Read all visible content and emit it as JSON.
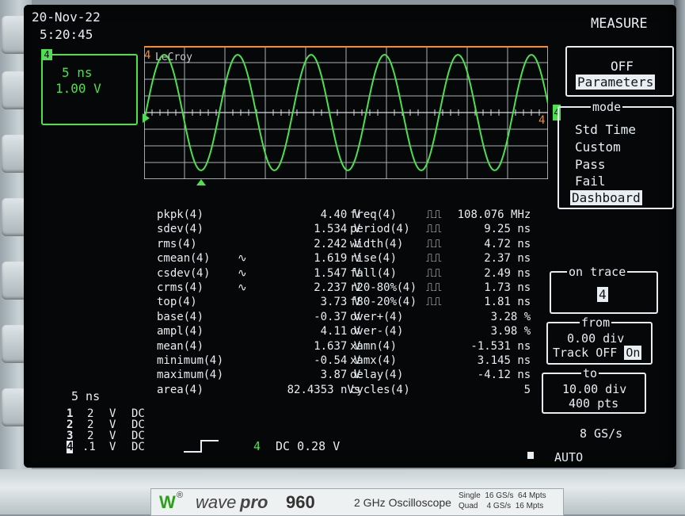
{
  "header": {
    "date": "20-Nov-22",
    "time": "5:20:45",
    "menu_title": "MEASURE"
  },
  "channel_box": {
    "badge": "4",
    "timebase": "5 ns",
    "volts": "1.00 V"
  },
  "trace": {
    "logo": "LeCroy",
    "marker_left": "4",
    "marker_right": "4",
    "color": "#4ee04e"
  },
  "menu": {
    "off_label": "OFF",
    "parameters_label": "Parameters",
    "mode_title": "mode",
    "modes": [
      "Std Time",
      "Custom",
      "Pass",
      "Fail",
      "Dashboard"
    ],
    "on_trace_title": "on trace",
    "on_trace_value": "4",
    "from_title": "from",
    "from_value": "0.00 div",
    "track_label": "Track",
    "track_off": "OFF",
    "track_on": "On",
    "to_title": "to",
    "to_value": "10.00 div",
    "to_pts": "400 pts",
    "sample_rate": "8 GS/s",
    "trigger_mode": "AUTO"
  },
  "measurements_left": [
    {
      "name": "pkpk",
      "ch": "4",
      "value": "4.40 V",
      "icon": ""
    },
    {
      "name": "sdev",
      "ch": "4",
      "value": "1.534 V",
      "icon": ""
    },
    {
      "name": "rms",
      "ch": "4",
      "value": "2.242 V",
      "icon": ""
    },
    {
      "name": "cmean",
      "ch": "4",
      "value": "1.619 V",
      "icon": "cycle"
    },
    {
      "name": "csdev",
      "ch": "4",
      "value": "1.547 V",
      "icon": "cycle"
    },
    {
      "name": "crms",
      "ch": "4",
      "value": "2.237 V",
      "icon": "cycle"
    },
    {
      "name": "top",
      "ch": "4",
      "value": "3.73 V",
      "icon": ""
    },
    {
      "name": "base",
      "ch": "4",
      "value": "-0.37 V",
      "icon": ""
    },
    {
      "name": "ampl",
      "ch": "4",
      "value": "4.11 V",
      "icon": ""
    },
    {
      "name": "mean",
      "ch": "4",
      "value": "1.637 V",
      "icon": ""
    },
    {
      "name": "minimum",
      "ch": "4",
      "value": "-0.54 V",
      "icon": ""
    },
    {
      "name": "maximum",
      "ch": "4",
      "value": "3.87 V",
      "icon": ""
    },
    {
      "name": "area",
      "ch": "4",
      "value": "82.4353 nVs",
      "icon": ""
    }
  ],
  "measurements_right": [
    {
      "name": "freq",
      "ch": "4",
      "value": "108.076 MHz",
      "icon": "pulse"
    },
    {
      "name": "period",
      "ch": "4",
      "value": "9.25 ns",
      "icon": "pulse"
    },
    {
      "name": "width",
      "ch": "4",
      "value": "4.72 ns",
      "icon": "pulse"
    },
    {
      "name": "rise",
      "ch": "4",
      "value": "2.37 ns",
      "icon": "pulse"
    },
    {
      "name": "fall",
      "ch": "4",
      "value": "2.49 ns",
      "icon": "pulse"
    },
    {
      "name": "r20-80%",
      "ch": "4",
      "value": "1.73 ns",
      "icon": "pulse"
    },
    {
      "name": "f80-20%",
      "ch": "4",
      "value": "1.81 ns",
      "icon": "pulse"
    },
    {
      "name": "over+",
      "ch": "4",
      "value": "3.28 %",
      "icon": ""
    },
    {
      "name": "over-",
      "ch": "4",
      "value": "3.98 %",
      "icon": ""
    },
    {
      "name": "xamn",
      "ch": "4",
      "value": "-1.531 ns",
      "icon": ""
    },
    {
      "name": "xamx",
      "ch": "4",
      "value": "3.145 ns",
      "icon": ""
    },
    {
      "name": "delay",
      "ch": "4",
      "value": "-4.12 ns",
      "icon": ""
    },
    {
      "name": "cycles",
      "ch": "4",
      "value": "5",
      "icon": ""
    }
  ],
  "channels_summary": {
    "timebase": "5 ns",
    "rows": [
      {
        "ch": "1",
        "scale": "2",
        "unit": "V",
        "coupling": "DC"
      },
      {
        "ch": "2",
        "scale": "2",
        "unit": "V",
        "coupling": "DC"
      },
      {
        "ch": "3",
        "scale": "2",
        "unit": "V",
        "coupling": "DC"
      },
      {
        "ch": "4",
        "scale": ".1",
        "unit": "V",
        "coupling": "DC"
      }
    ],
    "trigger_channel": "4",
    "trigger_info": "DC 0.28 V"
  },
  "brand": {
    "logo": "W",
    "name_italic": "wave",
    "name_bold": "pro",
    "model": "960",
    "description": "2 GHz Oscilloscope",
    "spec_single": "Single  16 GS/s  64 Mpts",
    "spec_quad": "Quad    4 GS/s  16 Mpts"
  }
}
